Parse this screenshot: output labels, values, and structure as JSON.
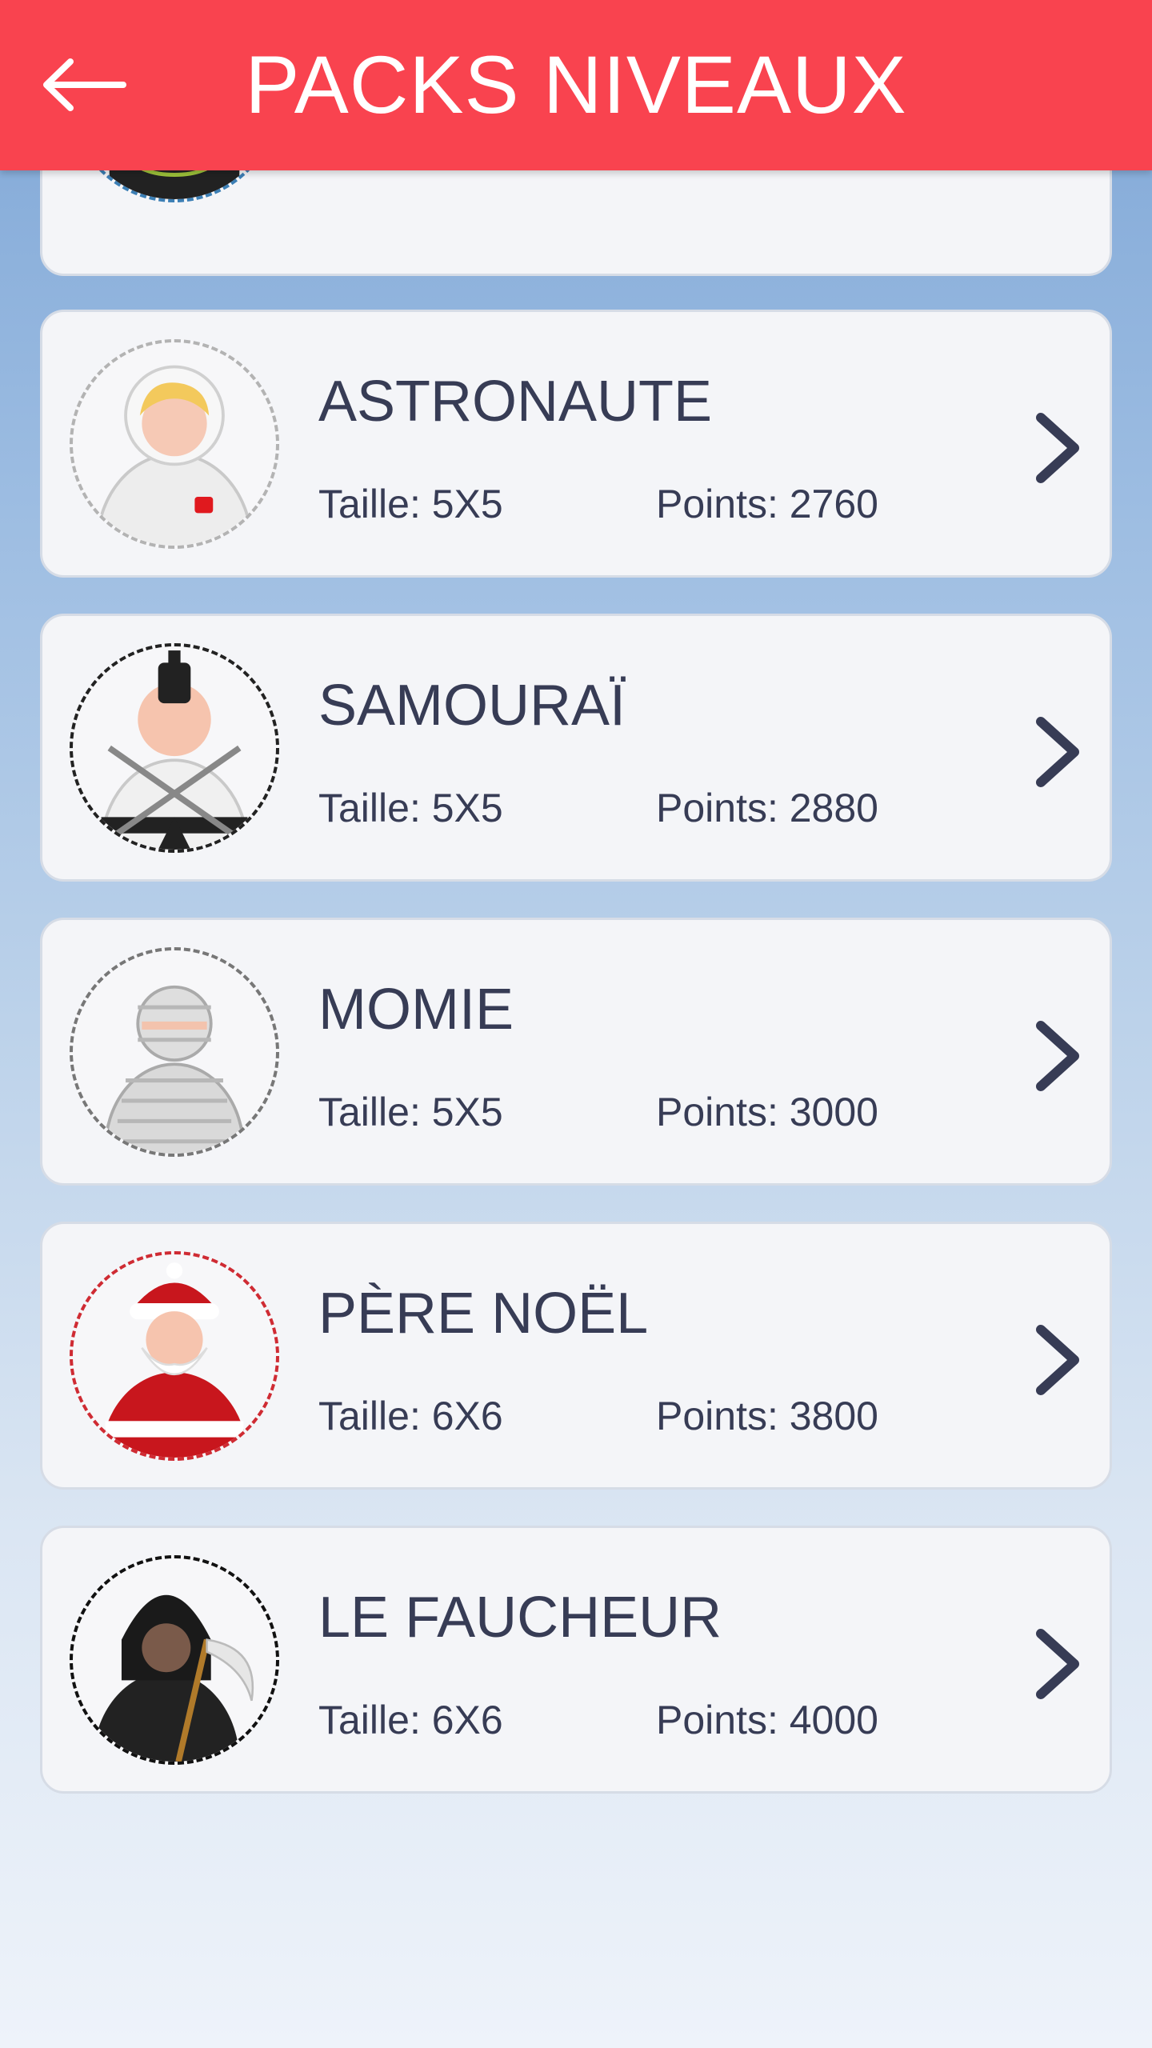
{
  "header": {
    "title": "PACKS NIVEAUX",
    "back_icon": "arrow-left-icon",
    "color": "#f9434f"
  },
  "packs": [
    {
      "name": "",
      "size": "",
      "points": "",
      "avatar": "partial-avatar",
      "partial": true
    },
    {
      "name": "ASTRONAUTE",
      "size": "Taille: 5X5",
      "points": "Points: 2760",
      "avatar": "astronaut-avatar-icon"
    },
    {
      "name": "SAMOURAÏ",
      "size": "Taille: 5X5",
      "points": "Points: 2880",
      "avatar": "samurai-avatar-icon"
    },
    {
      "name": "MOMIE",
      "size": "Taille: 5X5",
      "points": "Points: 3000",
      "avatar": "mummy-avatar-icon"
    },
    {
      "name": "PÈRE NOËL",
      "size": "Taille: 6X6",
      "points": "Points: 3800",
      "avatar": "santa-avatar-icon"
    },
    {
      "name": "LE FAUCHEUR",
      "size": "Taille: 6X6",
      "points": "Points: 4000",
      "avatar": "reaper-avatar-icon"
    }
  ],
  "colors": {
    "text": "#373c55",
    "card": "#f4f5f8"
  }
}
